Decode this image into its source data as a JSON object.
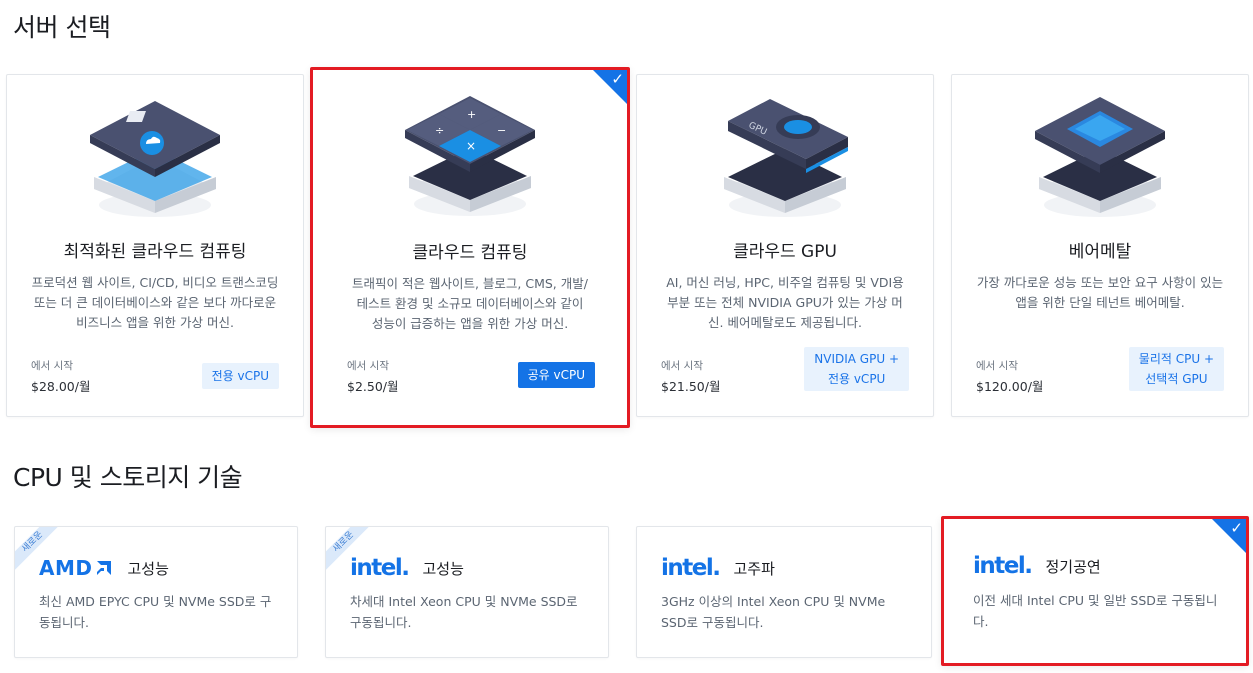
{
  "sections": {
    "server_title": "서버 선택",
    "cpu_title": "CPU 및 스토리지 기술"
  },
  "server_cards": [
    {
      "title": "최적화된 클라우드 컴퓨팅",
      "desc": "프로덕션 웹 사이트, CI/CD, 비디오 트랜스코딩 또는 더 큰 데이터베이스와 같은 보다 까다로운 비즈니스 앱을 위한 가상 머신.",
      "price_label": "에서 시작",
      "price": "$28.00/월",
      "tag": "전용 vCPU",
      "selected": false
    },
    {
      "title": "클라우드 컴퓨팅",
      "desc": "트래픽이 적은 웹사이트, 블로그, CMS, 개발/테스트 환경 및 소규모 데이터베이스와 같이 성능이 급증하는 앱을 위한 가상 머신.",
      "price_label": "에서 시작",
      "price": "$2.50/월",
      "tag": "공유 vCPU",
      "selected": true
    },
    {
      "title": "클라우드 GPU",
      "desc": "AI, 머신 러닝, HPC, 비주얼 컴퓨팅 및 VDI용 부분 또는 전체 NVIDIA GPU가 있는 가상 머신. 베어메탈로도 제공됩니다.",
      "price_label": "에서 시작",
      "price": "$21.50/월",
      "tag_line1": "NVIDIA GPU +",
      "tag_line2": "전용 vCPU",
      "selected": false
    },
    {
      "title": "베어메탈",
      "desc": "가장 까다로운 성능 또는 보안 요구 사항이 있는 앱을 위한 단일 테넌트 베어메탈.",
      "price_label": "에서 시작",
      "price": "$120.00/월",
      "tag_line1": "물리적 CPU +",
      "tag_line2": "선택적 GPU",
      "selected": false
    }
  ],
  "cpu_cards": [
    {
      "brand": "AMD",
      "tier": "고성능",
      "ribbon": "새로운",
      "desc": "최신 AMD EPYC CPU 및 NVMe SSD로 구동됩니다.",
      "selected": false
    },
    {
      "brand": "intel.",
      "tier": "고성능",
      "ribbon": "새로운",
      "desc": "차세대 Intel Xeon CPU 및 NVMe SSD로 구동됩니다.",
      "selected": false
    },
    {
      "brand": "intel.",
      "tier": "고주파",
      "desc": "3GHz 이상의 Intel Xeon CPU 및 NVMe SSD로 구동됩니다.",
      "selected": false
    },
    {
      "brand": "intel.",
      "tier": "정기공연",
      "desc": "이전 세대 Intel CPU 및 일반 SSD로 구동됩니다.",
      "selected": true
    }
  ],
  "icons": {
    "check": "✓"
  },
  "colors": {
    "accent": "#1473e6",
    "selected_border": "#e31b23",
    "tag_bg": "#e8f2fd"
  }
}
